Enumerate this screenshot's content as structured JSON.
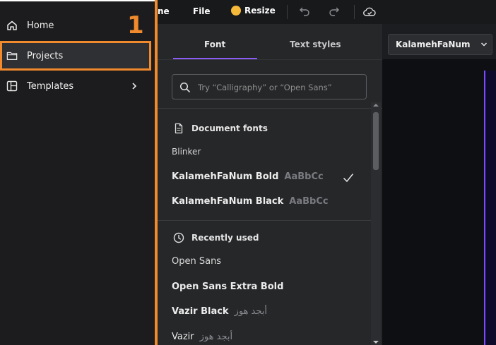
{
  "sidebar": {
    "items": [
      {
        "label": "Home",
        "icon": "home-icon"
      },
      {
        "label": "Projects",
        "icon": "folder-icon"
      },
      {
        "label": "Templates",
        "icon": "templates-icon"
      }
    ],
    "step_marker": "1"
  },
  "toolbar": {
    "home_label": "ne",
    "file_label": "File",
    "resize_label": "Resize"
  },
  "font_panel": {
    "tabs": [
      {
        "label": "Font",
        "active": true
      },
      {
        "label": "Text styles",
        "active": false
      }
    ],
    "search": {
      "placeholder": "Try “Calligraphy” or “Open Sans”"
    },
    "document_fonts": {
      "heading": "Document fonts",
      "items": [
        {
          "name": "Blinker",
          "sample": ""
        },
        {
          "name": "KalamehFaNum Bold",
          "sample": "AaBbCc",
          "selected": true
        },
        {
          "name": "KalamehFaNum Black",
          "sample": "AaBbCc"
        }
      ]
    },
    "recently_used": {
      "heading": "Recently used",
      "items": [
        {
          "name": "Open Sans",
          "sample": ""
        },
        {
          "name": "Open Sans Extra Bold",
          "sample": ""
        },
        {
          "name": "Vazir Black",
          "sample": "أبجد هوز"
        },
        {
          "name": "Vazir",
          "sample": "أبجد هوز"
        }
      ]
    }
  },
  "editor": {
    "font_selector_value": "KalamehFaNum"
  },
  "colors": {
    "highlight": "#f08a2c",
    "accent": "#8b5cf6",
    "sidebar_bg": "#1c1c1e",
    "panel_bg": "#262729"
  }
}
